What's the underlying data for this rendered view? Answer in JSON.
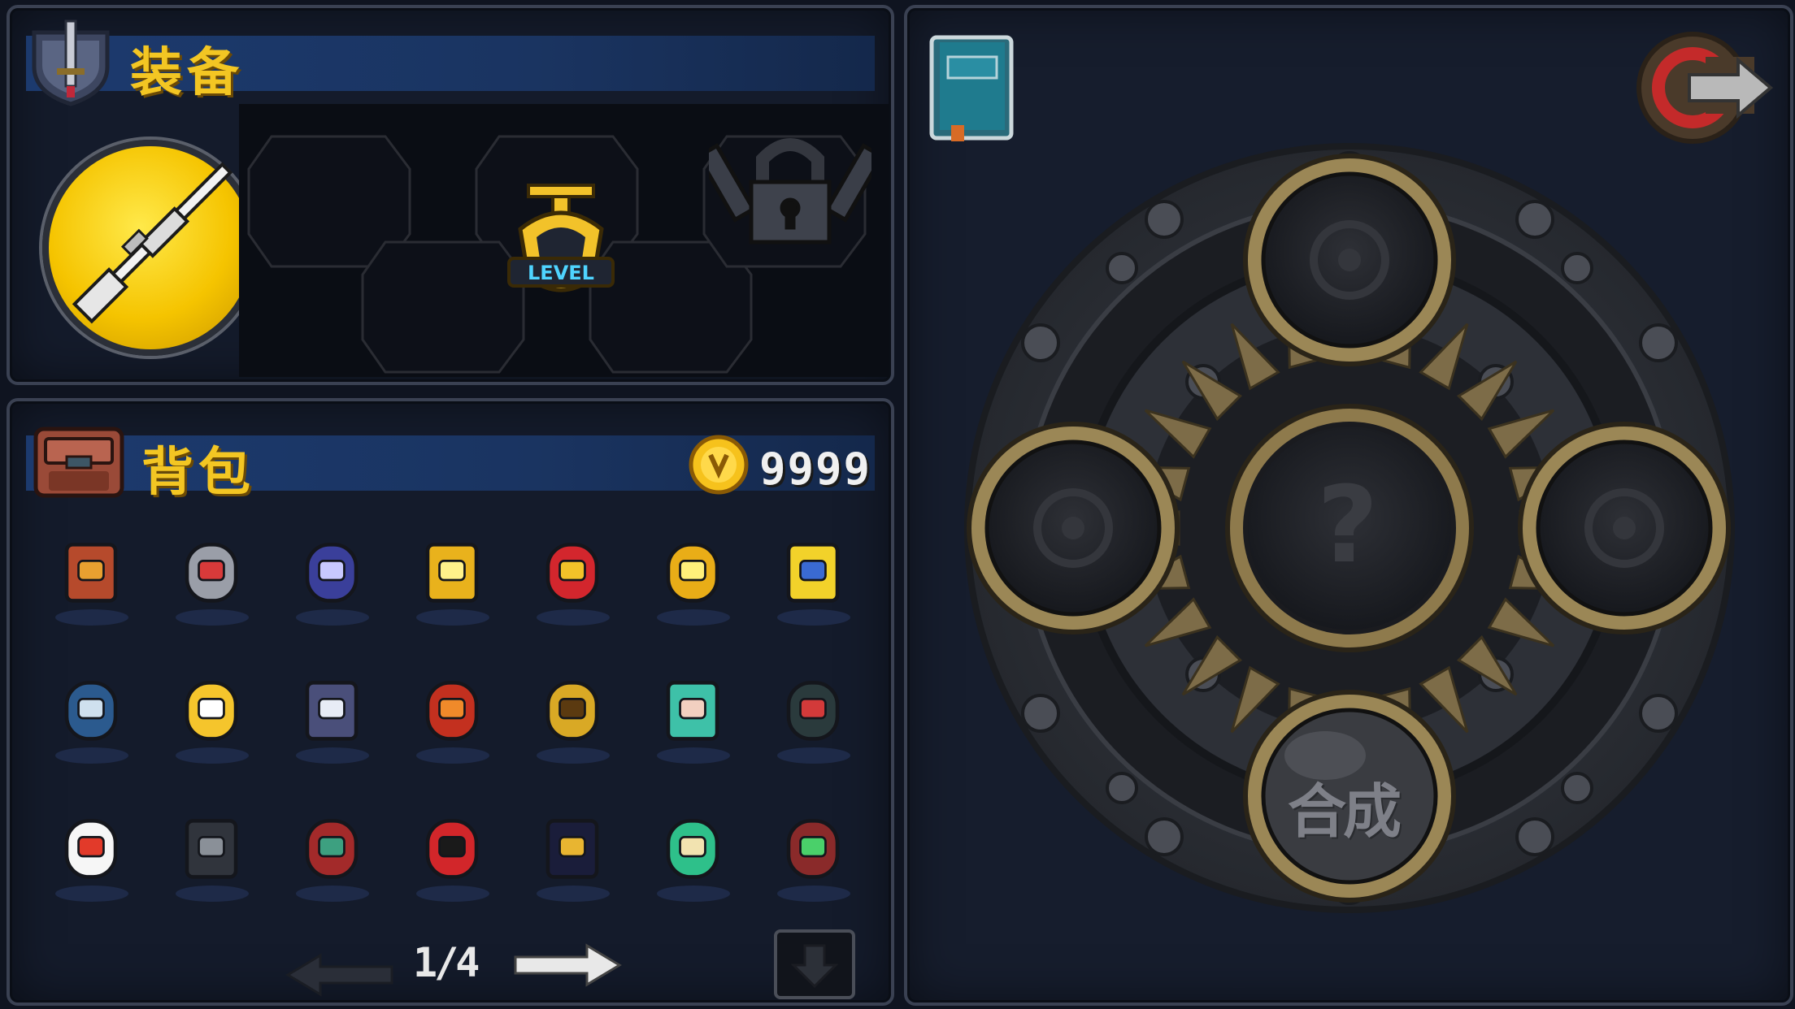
{
  "equipment": {
    "title": "装备",
    "weapon_icon": "rifle-icon",
    "level_badge": "LEVEL",
    "locked_icon": "padlock-icon",
    "empty_slots": 4
  },
  "backpack": {
    "title": "背包",
    "coins": "9999",
    "page": "1/4",
    "items": [
      {
        "name": "red-slot-machine-item"
      },
      {
        "name": "skull-slot-machine-item"
      },
      {
        "name": "fairy-item"
      },
      {
        "name": "golden-piggy-bank-item"
      },
      {
        "name": "seahorse-item"
      },
      {
        "name": "golden-bell-item"
      },
      {
        "name": "gold-ticket-item"
      },
      {
        "name": "horned-helmet-item"
      },
      {
        "name": "golden-glove-item"
      },
      {
        "name": "pufferfish-item"
      },
      {
        "name": "samurai-helmet-item"
      },
      {
        "name": "dollar-trophy-item"
      },
      {
        "name": "elf-head-item"
      },
      {
        "name": "skull-head-item"
      },
      {
        "name": "lucky-cat-item"
      },
      {
        "name": "armor-vest-item"
      },
      {
        "name": "feather-pot-item"
      },
      {
        "name": "fuel-can-item"
      },
      {
        "name": "bomb-pendant-item"
      },
      {
        "name": "green-mushroom-item"
      },
      {
        "name": "werewolf-head-item"
      }
    ]
  },
  "craft": {
    "center_symbol": "?",
    "craft_label": "合成",
    "book_icon": "recipe-book-icon",
    "exit_icon": "exit-arrow-icon"
  },
  "colors": {
    "title_yellow": "#f3c623",
    "header_blue": "#1c3a6e",
    "panel_bg": "#141b2b",
    "gold_ring": "#b39b5a"
  }
}
